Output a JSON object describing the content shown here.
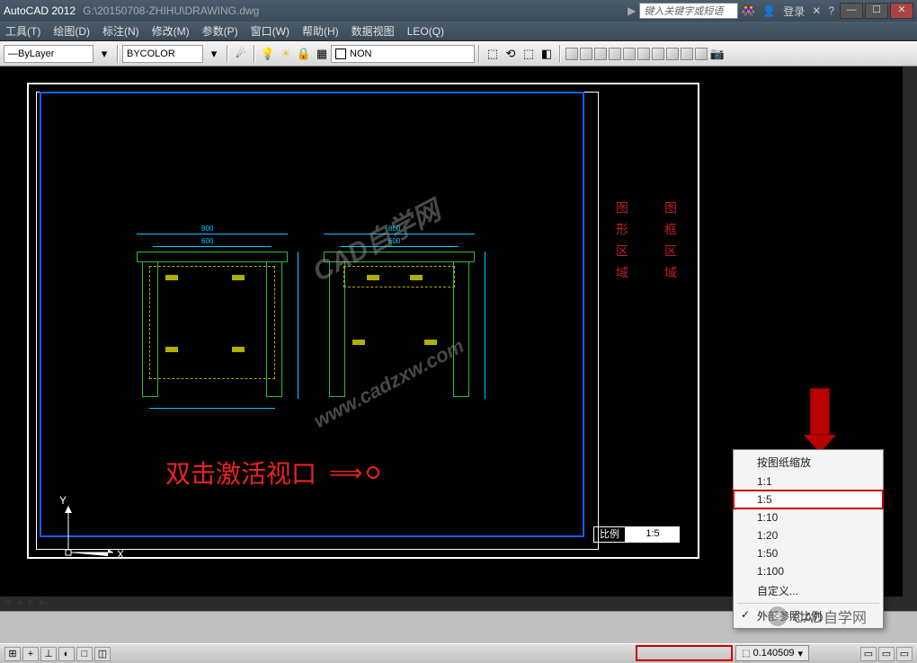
{
  "titlebar": {
    "app": "AutoCAD 2012",
    "filepath": "G:\\20150708-ZHIHU\\DRAWING.dwg",
    "search_placeholder": "键入关键字或短语",
    "login": "登录"
  },
  "menu": {
    "items": [
      "工具(T)",
      "绘图(D)",
      "标注(N)",
      "修改(M)",
      "参数(P)",
      "窗口(W)",
      "帮助(H)",
      "数据视图",
      "LEO(Q)"
    ]
  },
  "toolbar": {
    "layer_linetype": "ByLayer",
    "color_mode": "BYCOLOR",
    "layer_name": "NON"
  },
  "drawing": {
    "activate_text": "双击激活视口",
    "label_left": "图形区域",
    "label_right": "图框区域",
    "scale_label": "比例",
    "scale_value": "1:5",
    "dim_800": "800",
    "dim_600_1": "600",
    "dim_600_2": "600",
    "axis_x": "X",
    "axis_y": "Y"
  },
  "tabs": {
    "t1": "+",
    "t2": "+",
    "t3": "□",
    "t4": "□"
  },
  "popup": {
    "items": [
      "按图纸缩放",
      "1:1",
      "1:5",
      "1:10",
      "1:20",
      "1:50",
      "1:100",
      "自定义..."
    ],
    "hide": "外部参照比例"
  },
  "statusbar": {
    "scale": "0.140509"
  },
  "watermark": {
    "brand": "CAD自学网",
    "url": "www.cadzxw.com",
    "wechat": "CAD自学网"
  }
}
